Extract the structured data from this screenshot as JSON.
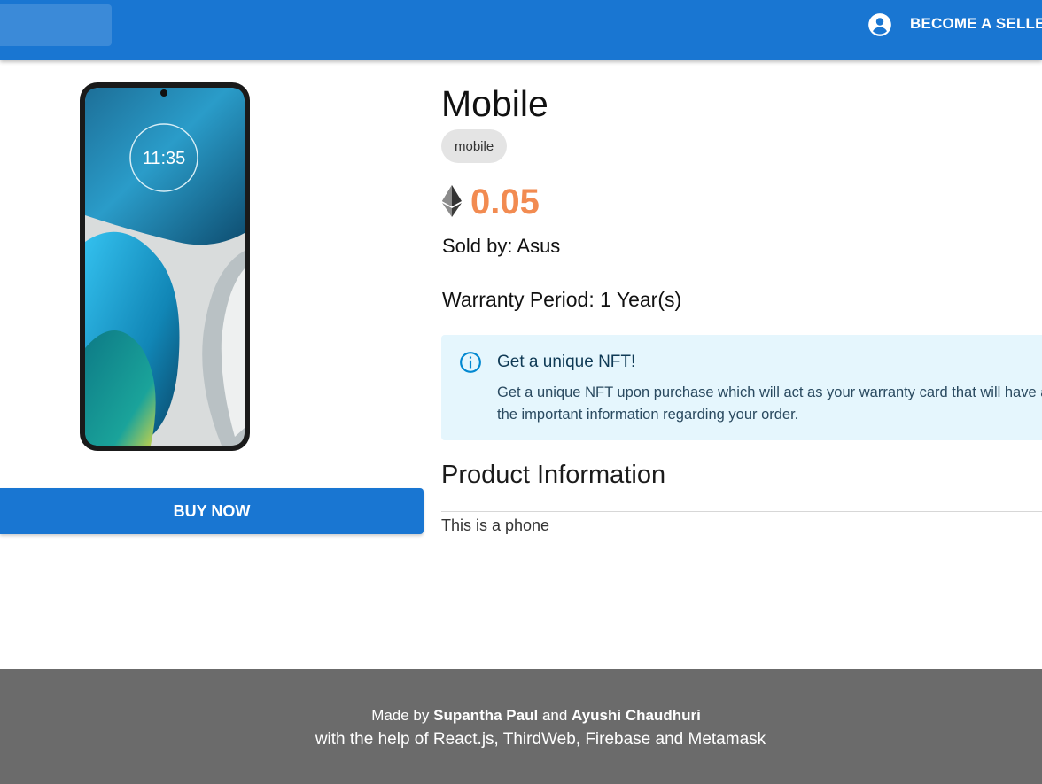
{
  "header": {
    "become_seller_label": "BECOME A SELLER",
    "account_icon": "account-circle-icon",
    "bar_color": "#1976d2"
  },
  "product": {
    "title": "Mobile",
    "category_chip": "mobile",
    "price": "0.05",
    "price_icon": "ethereum-icon",
    "price_color": "#f28b51",
    "sold_by": "Sold by: Asus",
    "warranty": "Warranty Period: 1 Year(s)",
    "image": {
      "icon": "phone-image",
      "clock_time": "11:35"
    },
    "buy_label": "BUY NOW"
  },
  "alert": {
    "icon": "info-icon",
    "title": "Get a unique NFT!",
    "text": "Get a unique NFT upon purchase which will act as your warranty card that will have all the important information regarding your order."
  },
  "product_information": {
    "heading": "Product Information",
    "description": "This is a phone"
  },
  "footer": {
    "made_by_prefix": "Made by",
    "author1": "Supantha Paul",
    "and": "and",
    "author2": "Ayushi Chaudhuri",
    "line2": "with the help of React.js, ThirdWeb, Firebase and Metamask"
  }
}
